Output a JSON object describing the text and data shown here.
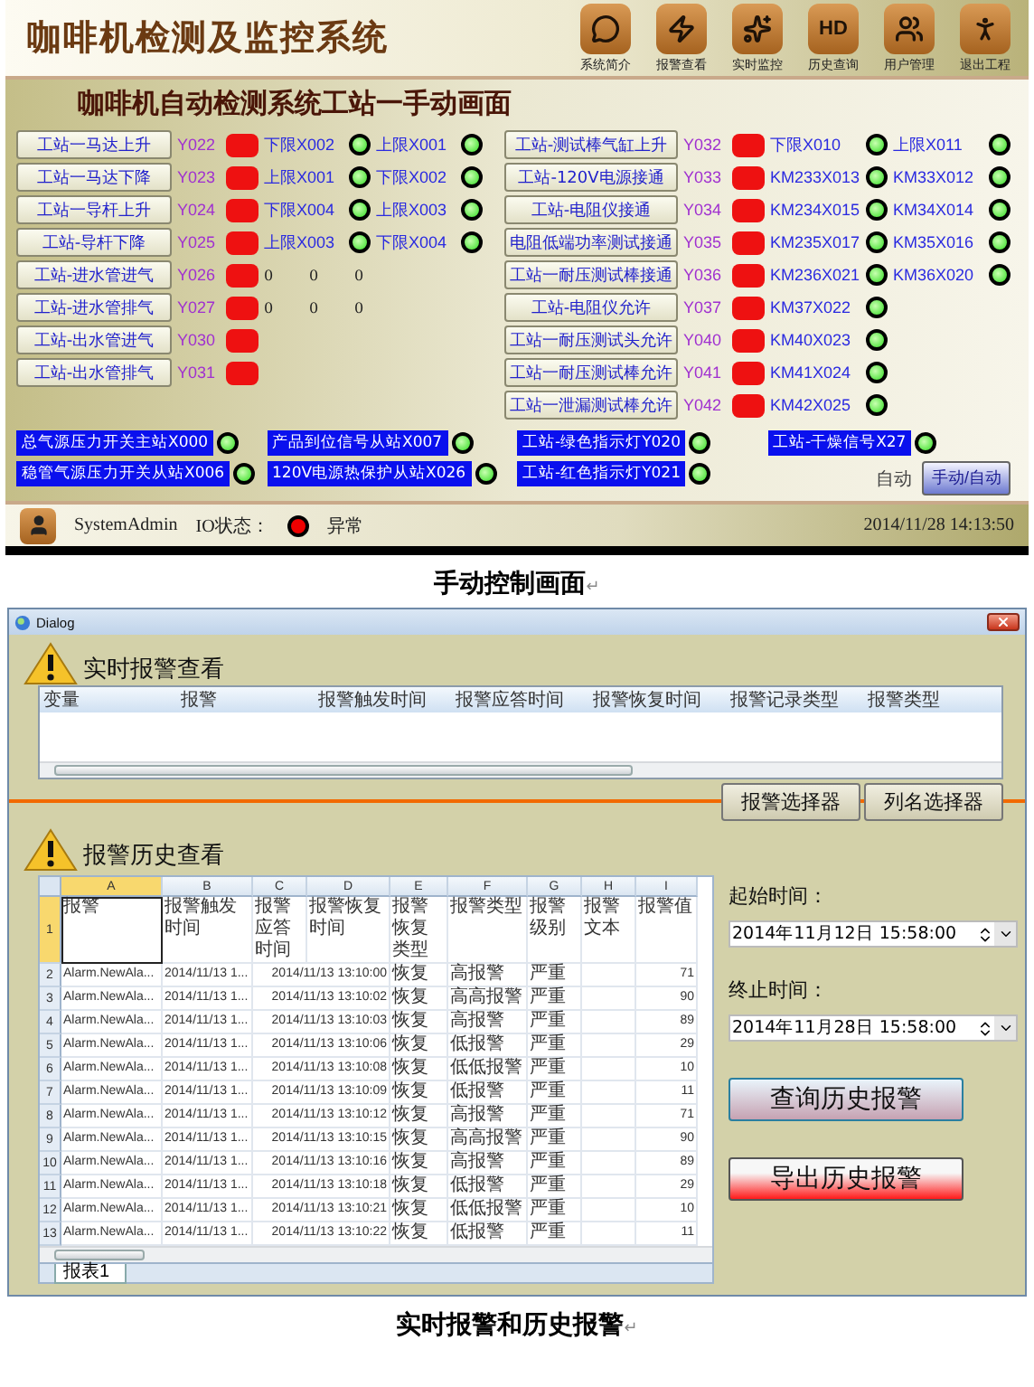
{
  "monitor": {
    "title": "咖啡机检测及监控系统",
    "nav": [
      {
        "label": "系统简介",
        "kind": "speech"
      },
      {
        "label": "报警查看",
        "kind": "bolt"
      },
      {
        "label": "实时监控",
        "kind": "sparkle"
      },
      {
        "label": "历史查询",
        "kind": "text",
        "glyph": "HD"
      },
      {
        "label": "用户管理",
        "kind": "people"
      },
      {
        "label": "退出工程",
        "kind": "runner"
      }
    ],
    "heading": "咖啡机自动检测系统工站一手动画面",
    "left_rows": [
      {
        "button": "工站一马达上升",
        "output": "Y022",
        "output_on": false,
        "inputs": [
          {
            "label": "下限X002",
            "on": true
          },
          {
            "label": "上限X001",
            "on": true
          }
        ]
      },
      {
        "button": "工站一马达下降",
        "output": "Y023",
        "output_on": false,
        "inputs": [
          {
            "label": "上限X001",
            "on": true
          },
          {
            "label": "下限X002",
            "on": true
          }
        ]
      },
      {
        "button": "工站一导杆上升",
        "output": "Y024",
        "output_on": false,
        "inputs": [
          {
            "label": "下限X004",
            "on": true
          },
          {
            "label": "上限X003",
            "on": true
          }
        ]
      },
      {
        "button": "工站-导杆下降",
        "output": "Y025",
        "output_on": false,
        "inputs": [
          {
            "label": "上限X003",
            "on": true
          },
          {
            "label": "下限X004",
            "on": true
          }
        ]
      },
      {
        "button": "工站-进水管进气",
        "output": "Y026",
        "output_on": false,
        "zeros": [
          "0",
          "0",
          "0"
        ]
      },
      {
        "button": "工站-进水管排气",
        "output": "Y027",
        "output_on": false,
        "zeros": [
          "0",
          "0",
          "0"
        ]
      },
      {
        "button": "工站-出水管进气",
        "output": "Y030",
        "output_on": false
      },
      {
        "button": "工站-出水管排气",
        "output": "Y031",
        "output_on": false
      }
    ],
    "right_rows": [
      {
        "button": "工站-测试棒气缸上升",
        "output": "Y032",
        "output_on": false,
        "inputs": [
          {
            "label": "下限X010",
            "on": true
          },
          {
            "label": "上限X011",
            "on": true
          }
        ]
      },
      {
        "button": "工站-120V电源接通",
        "output": "Y033",
        "output_on": false,
        "inputs": [
          {
            "label": "KM233X013",
            "on": true
          },
          {
            "label": "KM33X012",
            "on": true
          }
        ]
      },
      {
        "button": "工站-电阻仪接通",
        "output": "Y034",
        "output_on": false,
        "inputs": [
          {
            "label": "KM234X015",
            "on": true
          },
          {
            "label": "KM34X014",
            "on": true
          }
        ]
      },
      {
        "button": "电阻低端功率测试接通",
        "output": "Y035",
        "output_on": false,
        "inputs": [
          {
            "label": "KM235X017",
            "on": true
          },
          {
            "label": "KM35X016",
            "on": true
          }
        ]
      },
      {
        "button": "工站一耐压测试棒接通",
        "output": "Y036",
        "output_on": false,
        "inputs": [
          {
            "label": "KM236X021",
            "on": true
          },
          {
            "label": "KM36X020",
            "on": true
          }
        ]
      },
      {
        "button": "工站-电阻仪允许",
        "output": "Y037",
        "output_on": false,
        "inputs": [
          {
            "label": "KM37X022",
            "on": true
          }
        ]
      },
      {
        "button": "工站一耐压测试头允许",
        "output": "Y040",
        "output_on": false,
        "inputs": [
          {
            "label": "KM40X023",
            "on": true
          }
        ]
      },
      {
        "button": "工站一耐压测试棒允许",
        "output": "Y041",
        "output_on": false,
        "inputs": [
          {
            "label": "KM41X024",
            "on": true
          }
        ]
      },
      {
        "button": "工站一泄漏测试棒允许",
        "output": "Y042",
        "output_on": false,
        "inputs": [
          {
            "label": "KM42X025",
            "on": true
          }
        ]
      }
    ],
    "indicator_columns": [
      [
        {
          "label": "总气源压力开关主站X000",
          "on": true
        },
        {
          "label": "稳管气源压力开关从站X006",
          "on": true
        }
      ],
      [
        {
          "label": "产品到位信号从站X007",
          "on": true
        },
        {
          "label": "120V电源热保护从站X026",
          "on": true
        }
      ],
      [
        {
          "label": "工站-绿色指示灯Y020",
          "on": true
        },
        {
          "label": "工站-红色指示灯Y021",
          "on": true
        }
      ],
      [
        {
          "label": "工站-干燥信号X27",
          "on": true
        }
      ]
    ],
    "mode_label": "自动",
    "mode_button": "手动/自动",
    "status": {
      "user": "SystemAdmin",
      "io_label": "IO状态：",
      "io_ok": false,
      "io_text": "异常",
      "datetime": "2014/11/28 14:13:50"
    }
  },
  "captions": [
    {
      "text": "手动控制画面",
      "mark": "↵"
    },
    {
      "text": "实时报警和历史报警",
      "mark": "↵"
    }
  ],
  "dialog": {
    "title": "Dialog",
    "realtime_title": "实时报警查看",
    "realtime_columns": [
      "变量",
      "报警",
      "报警触发时间",
      "报警应答时间",
      "报警恢复时间",
      "报警记录类型",
      "报警类型"
    ],
    "buttons": [
      "报警选择器",
      "列名选择器"
    ],
    "history_title": "报警历史查看",
    "sheet": {
      "columns": [
        "A",
        "B",
        "C",
        "D",
        "E",
        "F",
        "G",
        "H",
        "I"
      ],
      "header_row": "1",
      "header_cells": [
        "报警",
        "报警触发时间",
        "报警应答时间",
        "报警恢复时间",
        "报警恢复类型",
        "报警类型",
        "报警级别",
        "报警文本",
        "报警值"
      ],
      "rows": [
        {
          "row": "2",
          "alarm": "Alarm.NewAla...",
          "trigger": "2014/11/13 1...",
          "restore_time": "2014/11/13 13:10:00",
          "restore_type": "恢复",
          "type": "高报警",
          "level": "严重",
          "value": "71"
        },
        {
          "row": "3",
          "alarm": "Alarm.NewAla...",
          "trigger": "2014/11/13 1...",
          "restore_time": "2014/11/13 13:10:02",
          "restore_type": "恢复",
          "type": "高高报警",
          "level": "严重",
          "value": "90"
        },
        {
          "row": "4",
          "alarm": "Alarm.NewAla...",
          "trigger": "2014/11/13 1...",
          "restore_time": "2014/11/13 13:10:03",
          "restore_type": "恢复",
          "type": "高报警",
          "level": "严重",
          "value": "89"
        },
        {
          "row": "5",
          "alarm": "Alarm.NewAla...",
          "trigger": "2014/11/13 1...",
          "restore_time": "2014/11/13 13:10:06",
          "restore_type": "恢复",
          "type": "低报警",
          "level": "严重",
          "value": "29"
        },
        {
          "row": "6",
          "alarm": "Alarm.NewAla...",
          "trigger": "2014/11/13 1...",
          "restore_time": "2014/11/13 13:10:08",
          "restore_type": "恢复",
          "type": "低低报警",
          "level": "严重",
          "value": "10"
        },
        {
          "row": "7",
          "alarm": "Alarm.NewAla...",
          "trigger": "2014/11/13 1...",
          "restore_time": "2014/11/13 13:10:09",
          "restore_type": "恢复",
          "type": "低报警",
          "level": "严重",
          "value": "11"
        },
        {
          "row": "8",
          "alarm": "Alarm.NewAla...",
          "trigger": "2014/11/13 1...",
          "restore_time": "2014/11/13 13:10:12",
          "restore_type": "恢复",
          "type": "高报警",
          "level": "严重",
          "value": "71"
        },
        {
          "row": "9",
          "alarm": "Alarm.NewAla...",
          "trigger": "2014/11/13 1...",
          "restore_time": "2014/11/13 13:10:15",
          "restore_type": "恢复",
          "type": "高高报警",
          "level": "严重",
          "value": "90"
        },
        {
          "row": "10",
          "alarm": "Alarm.NewAla...",
          "trigger": "2014/11/13 1...",
          "restore_time": "2014/11/13 13:10:16",
          "restore_type": "恢复",
          "type": "高报警",
          "level": "严重",
          "value": "89"
        },
        {
          "row": "11",
          "alarm": "Alarm.NewAla...",
          "trigger": "2014/11/13 1...",
          "restore_time": "2014/11/13 13:10:18",
          "restore_type": "恢复",
          "type": "低报警",
          "level": "严重",
          "value": "29"
        },
        {
          "row": "12",
          "alarm": "Alarm.NewAla...",
          "trigger": "2014/11/13 1...",
          "restore_time": "2014/11/13 13:10:21",
          "restore_type": "恢复",
          "type": "低低报警",
          "level": "严重",
          "value": "10"
        },
        {
          "row": "13",
          "alarm": "Alarm.NewAla...",
          "trigger": "2014/11/13 1...",
          "restore_time": "2014/11/13 13:10:22",
          "restore_type": "恢复",
          "type": "低报警",
          "level": "严重",
          "value": "11"
        }
      ],
      "tab": "报表1"
    },
    "fields": [
      {
        "label": "起始时间：",
        "value": "2014年11月12日 15:58:00"
      },
      {
        "label": "终止时间：",
        "value": "2014年11月28日 15:58:00"
      }
    ],
    "actions": [
      {
        "label": "查询历史报警",
        "kind": "query"
      },
      {
        "label": "导出历史报警",
        "kind": "export"
      }
    ]
  }
}
